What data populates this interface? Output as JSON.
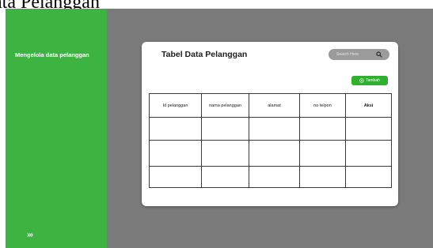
{
  "page": {
    "heading_fragment": "ata Pelanggan"
  },
  "sidebar": {
    "title": "Mengelola data pelanggan",
    "expand_label": "›››",
    "bg_color": "#3db441"
  },
  "workspace": {
    "bg_color": "#7a7a7a"
  },
  "card": {
    "title": "Tabel Data Pelanggan",
    "search": {
      "placeholder": "Search Here",
      "icon": "search-icon"
    },
    "add_button": {
      "label": "Tambah",
      "icon": "plus-circle-icon",
      "color": "#2fb02f"
    },
    "table": {
      "columns": [
        "Id pelanggan",
        "nama pelanggan",
        "alamat",
        "no telpon",
        "Aksi"
      ],
      "rows": [
        [
          "",
          "",
          "",
          "",
          ""
        ],
        [
          "",
          "",
          "",
          "",
          ""
        ],
        [
          "",
          "",
          "",
          "",
          ""
        ]
      ]
    }
  }
}
